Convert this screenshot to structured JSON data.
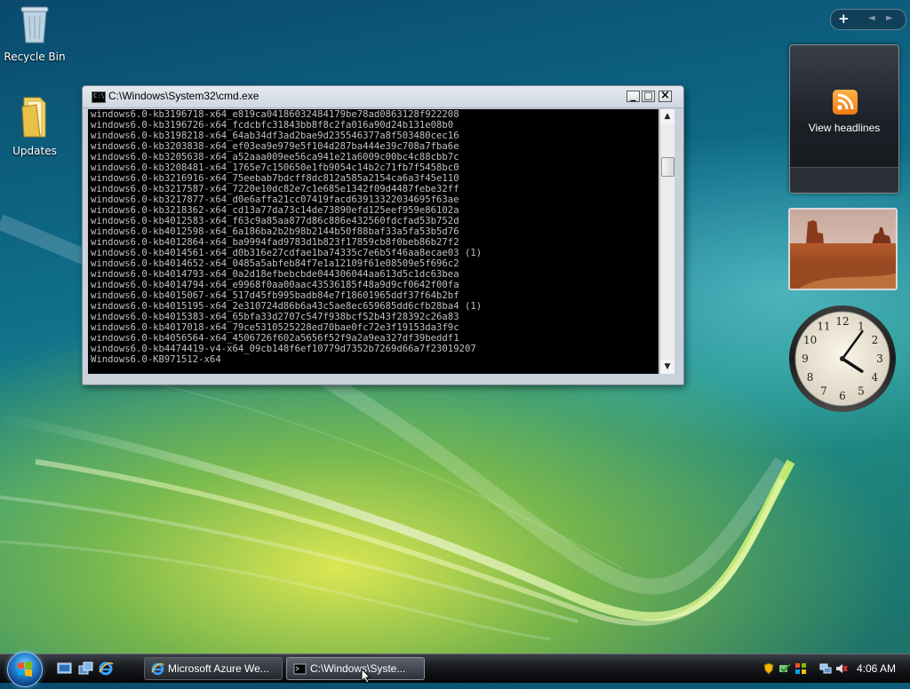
{
  "desktop": {
    "icons": [
      {
        "label": "Recycle Bin"
      },
      {
        "label": "Updates"
      }
    ]
  },
  "cmd_window": {
    "title": "C:\\Windows\\System32\\cmd.exe",
    "icon_text": "C:\\",
    "buttons": {
      "minimize": "_",
      "maximize": "□",
      "close": "×"
    },
    "lines": [
      "windows6.0-kb3196718-x64_e819ca04186032484179be78ad0863128f922208",
      "windows6.0-kb3196726-x64_fcdcbfc31843bb8f8c2fa016a90d24b131e08b0",
      "windows6.0-kb3198218-x64_64ab34df3ad2bae9d235546377a8f503480cec16",
      "windows6.0-kb3203838-x64_ef03ea9e979e5f104d287ba444e39c708a7fba6e",
      "windows6.0-kb3205638-x64_a52aaa009ee56ca941e21a6009c00bc4c88cbb7c",
      "windows6.0-kb3208481-x64_1765e7c150650e1fb9054c14b2c71fb7f5458bc0",
      "windows6.0-kb3216916-x64_75eebab7bdcff8dc812a585a2154ca6a3f45e110",
      "windows6.0-kb3217587-x64_7220e10dc82e7c1e685e1342f09d4487febe32ff",
      "windows6.0-kb3217877-x64_d0e6affa21cc07419facd63913322034695f63ae",
      "windows6.0-kb3218362-x64_cd13a77da73c14de73890efd125eef959e86102a",
      "windows6.0-kb4012583-x64_f63c9a85aa877d86c886e432560fdcfad53b752d",
      "windows6.0-kb4012598-x64_6a186ba2b2b98b2144b50f88baf33a5fa53b5d76",
      "windows6.0-kb4012864-x64_ba9994fad9783d1b823f17859cb8f0beb86b27f2",
      "windows6.0-kb4014561-x64_d0b316e27cdfae1ba74335c7e6b5f46aa8ecae03 (1)",
      "windows6.0-kb4014652-x64_0485a5abfeb84f7e1a12109f61e08509e5f696c2",
      "windows6.0-kb4014793-x64_0a2d18efbebcbde044306044aa613d5c1dc63bea",
      "windows6.0-kb4014794-x64_e9968f0aa00aac43536185f48a9d9cf0642f00fa",
      "windows6.0-kb4015067-x64_517d45fb995badb84e7f18601965ddf37f64b2bf",
      "windows6.0-kb4015195-x64_2e310724d86b6a43c5ae8ec659685dd6cfb28ba4 (1)",
      "windows6.0-kb4015383-x64_65bfa33d2707c547f938bcf52b43f28392c26a83",
      "windows6.0-kb4017018-x64_79ce5310525228ed70bae0fc72e3f19153da3f9c",
      "windows6.0-kb4056564-x64_4506726f602a5656f52f9a2a9ea327df39beddf1",
      "windows6.0-kb4474419-v4-x64_09cb148f6ef10779d7352b7269d66a7f23019207",
      "Windows6.0-KB971512-x64"
    ],
    "scroll": {
      "up": "▲",
      "down": "▼"
    }
  },
  "sidebar": {
    "controls": {
      "add": "+",
      "prev": "◄",
      "next": "►"
    },
    "feed_gadget": {
      "label": "View headlines"
    },
    "clock": {
      "hour": 4,
      "minute": 6,
      "numerals": [
        "12",
        "1",
        "2",
        "3",
        "4",
        "5",
        "6",
        "7",
        "8",
        "9",
        "10",
        "11"
      ]
    }
  },
  "taskbar": {
    "buttons": [
      {
        "label": "Microsoft Azure We..."
      },
      {
        "label": "C:\\Windows\\Syste..."
      }
    ],
    "clock": "4:06 AM"
  },
  "colors": {
    "console_bg": "#000000",
    "console_text": "#c0c0c0",
    "taskbar": "#17191d"
  }
}
